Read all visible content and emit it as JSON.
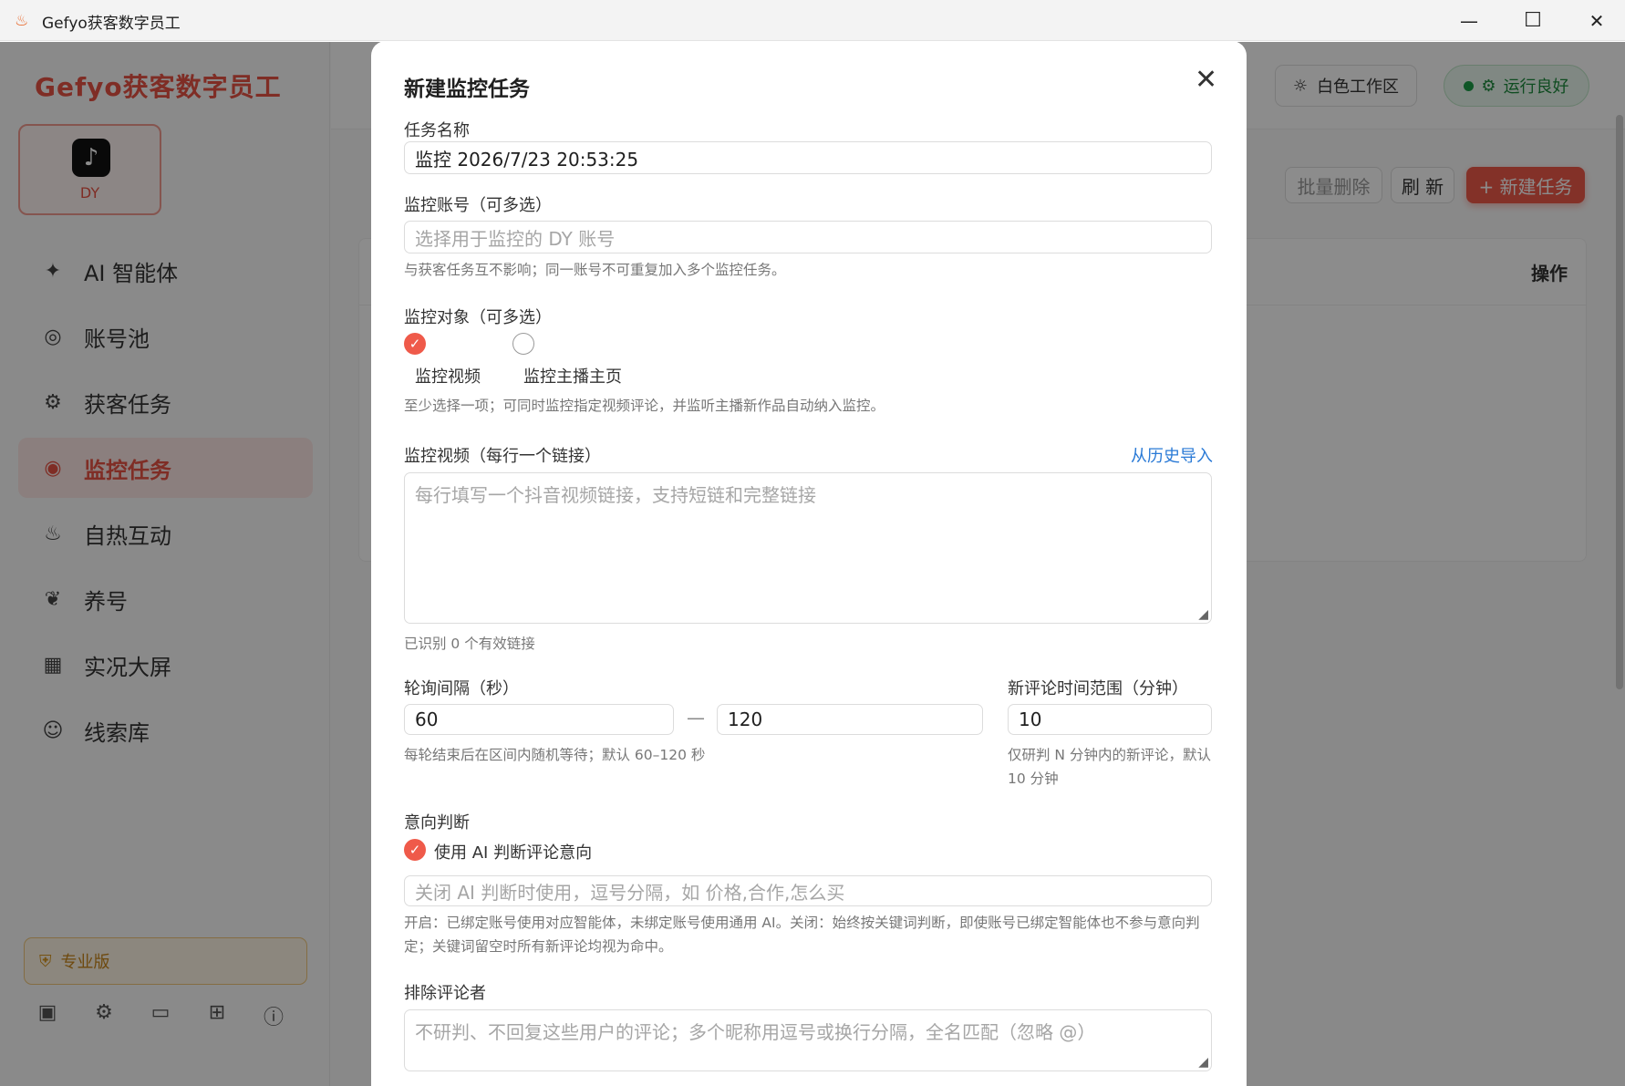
{
  "window": {
    "title": "Gefyo获客数字员工",
    "minimize": "—",
    "maximize": "☐",
    "close": "✕"
  },
  "sidebar": {
    "brand": "Gefyo获客数字员工",
    "platform": {
      "label": "DY",
      "logo": "♪"
    },
    "nav": [
      {
        "label": "AI 智能体",
        "icon": "sparkle-icon",
        "glyph": "✦"
      },
      {
        "label": "账号池",
        "icon": "user-circle-icon",
        "glyph": "◎"
      },
      {
        "label": "获客任务",
        "icon": "gear-icon",
        "glyph": "⚙"
      },
      {
        "label": "监控任务",
        "icon": "eye-scan-icon",
        "glyph": "◉"
      },
      {
        "label": "自热互动",
        "icon": "flame-icon",
        "glyph": "♨"
      },
      {
        "label": "养号",
        "icon": "sprout-icon",
        "glyph": "❦"
      },
      {
        "label": "实况大屏",
        "icon": "grid-icon",
        "glyph": "▦"
      },
      {
        "label": "线索库",
        "icon": "users-icon",
        "glyph": "☺"
      }
    ],
    "edition": "专业版",
    "bottom_icons": [
      {
        "name": "chip-icon",
        "glyph": "▣"
      },
      {
        "name": "settings-icon",
        "glyph": "⚙"
      },
      {
        "name": "chat-icon",
        "glyph": "▭"
      },
      {
        "name": "book-icon",
        "glyph": "⊞"
      },
      {
        "name": "info-icon",
        "glyph": "ⓘ"
      }
    ]
  },
  "topbar": {
    "workspace": "白色工作区",
    "workspace_icon": "☼",
    "status": "运行良好",
    "status_icon": "⚙"
  },
  "toolbar": {
    "batch_delete": "批量删除",
    "refresh": "刷 新",
    "new_task": "+ 新建任务"
  },
  "table": {
    "ops_header": "操作"
  },
  "modal": {
    "title": "新建监控任务",
    "close": "✕",
    "task_name": {
      "label": "任务名称",
      "value": "监控 2026/7/23 20:53:25"
    },
    "accounts": {
      "label": "监控账号（可多选）",
      "placeholder": "选择用于监控的 DY 账号",
      "hint": "与获客任务互不影响；同一账号不可重复加入多个监控任务。"
    },
    "targets": {
      "label": "监控对象（可多选）",
      "options": [
        {
          "label": "监控视频",
          "checked": true
        },
        {
          "label": "监控主播主页",
          "checked": false
        }
      ],
      "hint": "至少选择一项；可同时监控指定视频评论，并监听主播新作品自动纳入监控。"
    },
    "videos": {
      "label": "监控视频（每行一个链接）",
      "import_link": "从历史导入",
      "placeholder": "每行填写一个抖音视频链接，支持短链和完整链接",
      "count_hint": "已识别 0 个有效链接"
    },
    "poll": {
      "label": "轮询间隔（秒）",
      "min": "60",
      "max": "120",
      "separator": "—",
      "hint": "每轮结束后在区间内随机等待；默认 60–120 秒"
    },
    "range": {
      "label": "新评论时间范围（分钟）",
      "value": "10",
      "hint": "仅研判 N 分钟内的新评论，默认 10 分钟"
    },
    "intent": {
      "label": "意向判断",
      "use_ai_label": "使用 AI 判断评论意向",
      "use_ai_checked": true,
      "placeholder": "关闭 AI 判断时使用，逗号分隔，如 价格,合作,怎么买",
      "hint": "开启：已绑定账号使用对应智能体，未绑定账号使用通用 AI。关闭：始终按关键词判断，即使账号已绑定智能体也不参与意向判定；关键词留空时所有新评论均视为命中。"
    },
    "exclude": {
      "label": "排除评论者",
      "placeholder": "不研判、不回复这些用户的评论；多个昵称用逗号或换行分隔，全名匹配（忽略 @）"
    }
  }
}
